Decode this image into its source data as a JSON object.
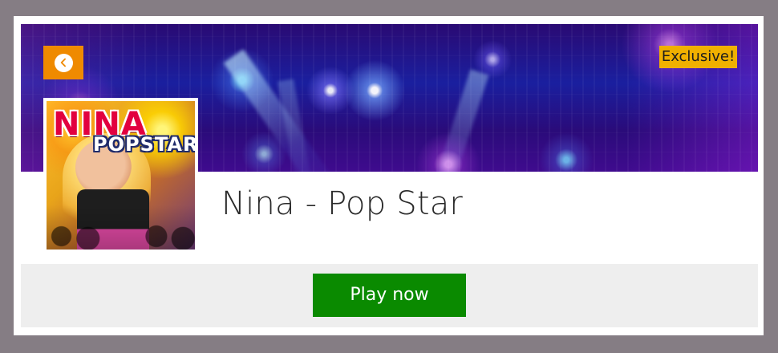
{
  "colors": {
    "page_background": "#857d84",
    "card_background": "#ffffff",
    "back_button": "#ef8a00",
    "exclusive_badge": "#f0b000",
    "play_button": "#0a8a00",
    "footer_background": "#eeeeee",
    "title_text": "#2a2a2a"
  },
  "header": {
    "exclusive_label": "Exclusive!",
    "back_icon": "chevron-left-circle-icon"
  },
  "game": {
    "title": "Nina - Pop Star",
    "thumbnail": {
      "title": "NINA",
      "subtitle": "POPSTAR"
    }
  },
  "actions": {
    "play_label": "Play now"
  }
}
